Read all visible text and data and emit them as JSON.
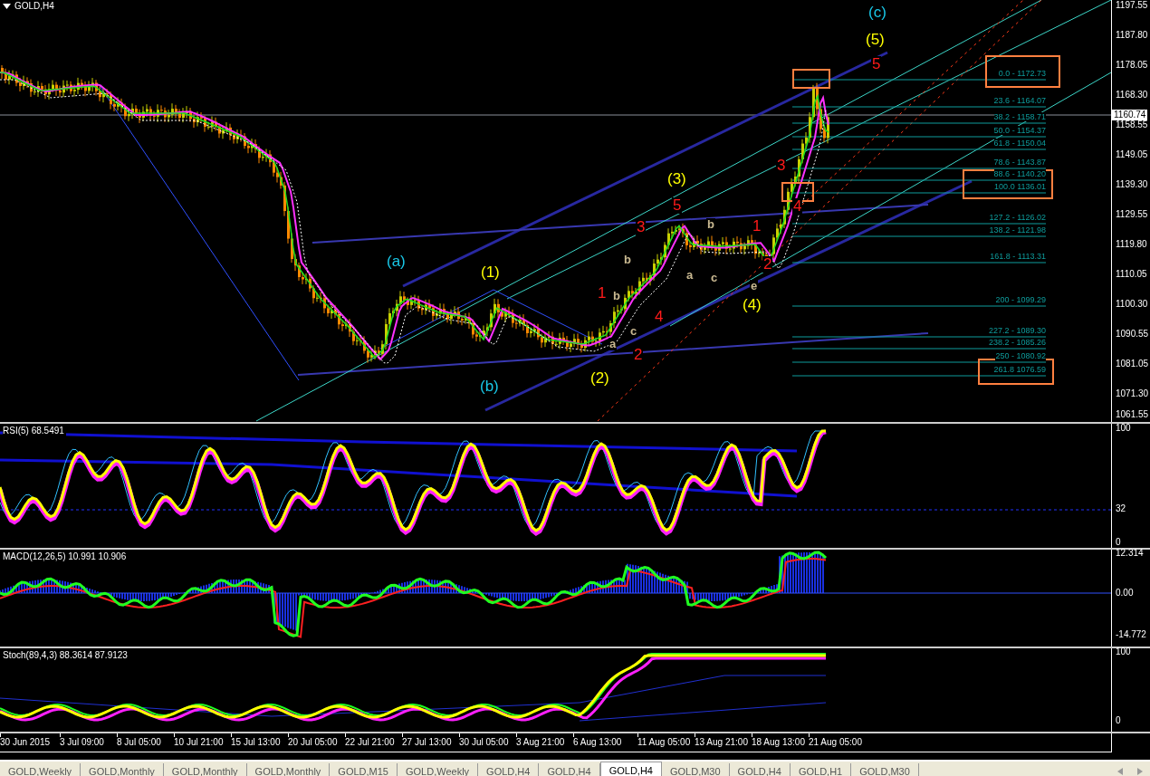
{
  "chart": {
    "title": "GOLD,H4",
    "wave_labels": [
      {
        "text": "(c)",
        "color": "#19c8e8"
      },
      {
        "text": "(5)",
        "color": "#ffff00"
      },
      {
        "text": "5",
        "color": "#ff1a1a"
      },
      {
        "text": "(3)",
        "color": "#ffff00"
      },
      {
        "text": "5",
        "color": "#ff1a1a"
      },
      {
        "text": "3",
        "color": "#ff1a1a"
      },
      {
        "text": "b",
        "color": "#c8b890"
      },
      {
        "text": "b",
        "color": "#c8b890"
      },
      {
        "text": "b",
        "color": "#c8b890"
      },
      {
        "text": "1",
        "color": "#ff1a1a"
      },
      {
        "text": "c",
        "color": "#c8b890"
      },
      {
        "text": "a",
        "color": "#c8b890"
      },
      {
        "text": "4",
        "color": "#ff1a1a"
      },
      {
        "text": "2",
        "color": "#ff1a1a"
      },
      {
        "text": "(2)",
        "color": "#ffff00"
      },
      {
        "text": "(1)",
        "color": "#ffff00"
      },
      {
        "text": "(a)",
        "color": "#19c8e8"
      },
      {
        "text": "(b)",
        "color": "#19c8e8"
      },
      {
        "text": "3",
        "color": "#ff1a1a"
      },
      {
        "text": "4",
        "color": "#ff1a1a"
      },
      {
        "text": "1",
        "color": "#ff1a1a"
      },
      {
        "text": "2",
        "color": "#ff1a1a"
      },
      {
        "text": "a",
        "color": "#c8b890"
      },
      {
        "text": "c",
        "color": "#c8b890"
      },
      {
        "text": "e",
        "color": "#c8b890"
      },
      {
        "text": "(4)",
        "color": "#ffff00"
      }
    ],
    "fibonacci_levels": [
      "0.0 - 1172.73",
      "23.6 - 1164.07",
      "38.2 - 1158.71",
      "50.0 - 1154.37",
      "61.8 - 1150.04",
      "78.6 - 1143.87",
      "88.6 - 1140.20",
      "100.0 1136.01",
      "127.2 - 1126.02",
      "138.2 - 1121.98",
      "161.8 - 1113.31",
      "200 - 1099.29",
      "227.2 - 1089.30",
      "238.2 - 1085.26",
      "250 - 1080.92",
      "261.8 1076.59"
    ],
    "price_axis": [
      "1197.55",
      "1187.80",
      "1178.05",
      "1168.30",
      "1158.55",
      "1149.05",
      "1139.30",
      "1129.55",
      "1119.80",
      "1110.05",
      "1100.30",
      "1090.55",
      "1081.05",
      "1071.30",
      "1061.55"
    ],
    "current_price": "1160.74"
  },
  "indicators": [
    {
      "kind": "rsi",
      "title": "RSI(5) 68.5491",
      "scale": [
        "100",
        "32",
        "0"
      ]
    },
    {
      "kind": "macd",
      "title": "MACD(12,26,5) 10.991 10.906",
      "scale": [
        "12.314",
        "0.00",
        "-14.772"
      ]
    },
    {
      "kind": "stoch",
      "title": "Stoch(89,4,3) 88.3614 87.9123",
      "scale": [
        "100",
        "0"
      ]
    }
  ],
  "time_axis": [
    "30 Jun 2015",
    "3 Jul 09:00",
    "8 Jul 05:00",
    "10 Jul 21:00",
    "15 Jul 13:00",
    "20 Jul 05:00",
    "22 Jul 21:00",
    "27 Jul 13:00",
    "30 Jul 05:00",
    "3 Aug 21:00",
    "6 Aug 13:00",
    "11 Aug 05:00",
    "13 Aug 21:00",
    "18 Aug 13:00",
    "21 Aug 05:00"
  ],
  "tabs": [
    {
      "label": "GOLD,Weekly",
      "selected": false
    },
    {
      "label": "GOLD,Monthly",
      "selected": false
    },
    {
      "label": "GOLD,Monthly",
      "selected": false
    },
    {
      "label": "GOLD,Monthly",
      "selected": false
    },
    {
      "label": "GOLD,M15",
      "selected": false
    },
    {
      "label": "GOLD,Weekly",
      "selected": false
    },
    {
      "label": "GOLD,H4",
      "selected": false
    },
    {
      "label": "GOLD,H4",
      "selected": false
    },
    {
      "label": "GOLD,H4",
      "selected": true
    },
    {
      "label": "GOLD,M30",
      "selected": false
    },
    {
      "label": "GOLD,H4",
      "selected": false
    },
    {
      "label": "GOLD,H1",
      "selected": false
    },
    {
      "label": "GOLD,M30",
      "selected": false
    }
  ]
}
